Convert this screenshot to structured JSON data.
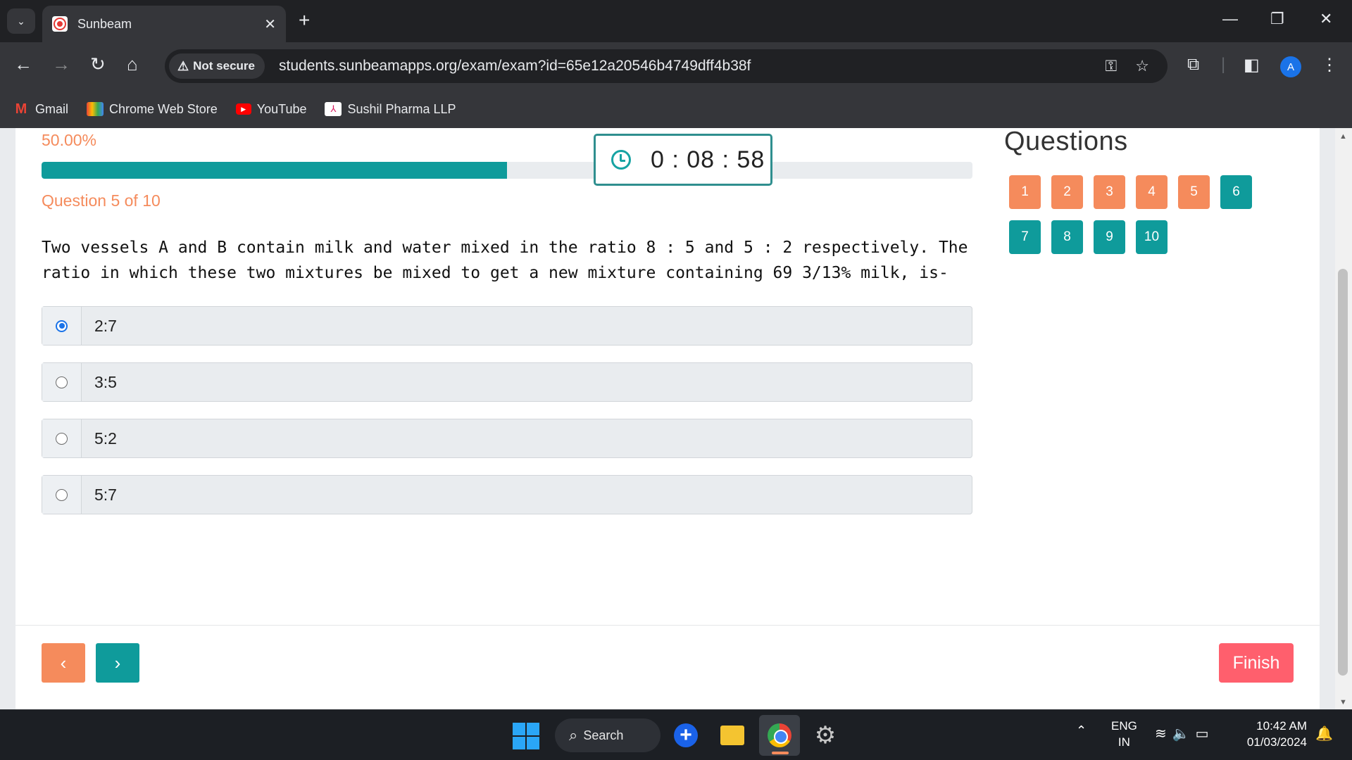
{
  "browser": {
    "tab_title": "Sunbeam",
    "close_glyph": "✕",
    "new_tab_glyph": "+",
    "security_label": "Not secure",
    "url": "students.sunbeamapps.org/exam/exam?id=65e12a20546b4749dff4b38f",
    "avatar_letter": "A",
    "bookmarks": [
      {
        "label": "Gmail",
        "icon": "gmail-icon"
      },
      {
        "label": "Chrome Web Store",
        "icon": "chrome-web-store-icon"
      },
      {
        "label": "YouTube",
        "icon": "youtube-icon"
      },
      {
        "label": "Sushil Pharma LLP",
        "icon": "sushil-pharma-icon"
      }
    ]
  },
  "exam": {
    "progress_percent_label": "50.00%",
    "progress_fraction": 0.5,
    "timer": "0 : 08 : 58",
    "question_counter": "Question 5 of 10",
    "question_text": "Two vessels A and B contain milk and water mixed in the ratio 8 : 5 and 5 : 2 respectively. The ratio in which these two mixtures be mixed to get a new mixture containing 69 3/13% milk, is-",
    "options": [
      {
        "label": "2:7",
        "selected": true
      },
      {
        "label": "3:5",
        "selected": false
      },
      {
        "label": "5:2",
        "selected": false
      },
      {
        "label": "5:7",
        "selected": false
      }
    ],
    "prev_glyph": "‹",
    "next_glyph": "›",
    "finish_label": "Finish"
  },
  "palette": {
    "title": "Questions",
    "questions": [
      {
        "number": "1",
        "state": "answered"
      },
      {
        "number": "2",
        "state": "answered"
      },
      {
        "number": "3",
        "state": "answered"
      },
      {
        "number": "4",
        "state": "answered"
      },
      {
        "number": "5",
        "state": "answered"
      },
      {
        "number": "6",
        "state": "pending"
      },
      {
        "number": "7",
        "state": "pending"
      },
      {
        "number": "8",
        "state": "pending"
      },
      {
        "number": "9",
        "state": "pending"
      },
      {
        "number": "10",
        "state": "pending"
      }
    ]
  },
  "taskbar": {
    "search_label": "Search",
    "lang_line1": "ENG",
    "lang_line2": "IN",
    "time": "10:42 AM",
    "date": "01/03/2024"
  },
  "colors": {
    "accent_orange": "#f58b5c",
    "accent_teal": "#0f9b9b",
    "finish_red": "#ff5f6d",
    "radio_blue": "#1a73e8"
  }
}
